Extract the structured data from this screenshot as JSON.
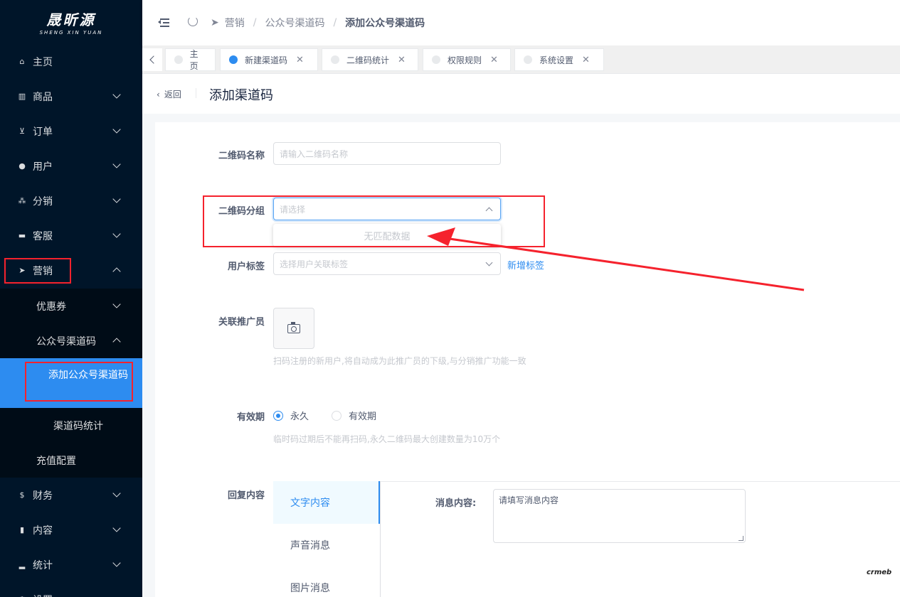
{
  "sidebar": {
    "logo_main": "晟昕源",
    "logo_sub": "SHENG XIN YUAN",
    "items": [
      {
        "label": "主页",
        "icon": "home-icon"
      },
      {
        "label": "商品",
        "icon": "shop-icon"
      },
      {
        "label": "订单",
        "icon": "cart-icon"
      },
      {
        "label": "用户",
        "icon": "user-icon"
      },
      {
        "label": "分销",
        "icon": "team-icon"
      },
      {
        "label": "客服",
        "icon": "chat-icon"
      },
      {
        "label": "营销",
        "icon": "send-icon"
      }
    ],
    "marketing_sub": {
      "coupon": "优惠券",
      "channel": "公众号渠道码",
      "add_channel": "添加公众号渠道码",
      "channel_stats": "渠道码统计",
      "recharge": "充值配置"
    },
    "bottom_items": [
      {
        "label": "财务",
        "icon": "dollar-icon"
      },
      {
        "label": "内容",
        "icon": "book-icon"
      },
      {
        "label": "统计",
        "icon": "bar-chart-icon"
      },
      {
        "label": "设置",
        "icon": "gear-icon"
      }
    ]
  },
  "header": {
    "breadcrumb": [
      "营销",
      "公众号渠道码",
      "添加公众号渠道码"
    ]
  },
  "tabs": [
    {
      "label": "主页"
    },
    {
      "label": "新建渠道码"
    },
    {
      "label": "二维码统计"
    },
    {
      "label": "权限规则"
    },
    {
      "label": "系统设置"
    }
  ],
  "page": {
    "back": "返回",
    "title": "添加渠道码"
  },
  "form": {
    "qr_name_label": "二维码名称",
    "qr_name_placeholder": "请输入二维码名称",
    "qr_group_label": "二维码分组",
    "qr_group_placeholder": "请选择",
    "qr_group_empty": "无匹配数据",
    "user_tag_label": "用户标签",
    "user_tag_placeholder": "选择用户关联标签",
    "add_tag": "新增标签",
    "promoter_label": "关联推广员",
    "promoter_tip": "扫码注册的新用户,将自动成为此推广员的下级,与分销推广功能一致",
    "validity_label": "有效期",
    "validity_options": [
      "永久",
      "有效期"
    ],
    "validity_tip": "临时码过期后不能再扫码,永久二维码最大创建数量为10万个",
    "reply_label": "回复内容",
    "reply_types": [
      "文字内容",
      "声音消息",
      "图片消息"
    ],
    "message_label": "消息内容:",
    "message_placeholder": "请填写消息内容"
  },
  "brand_mark": "crmeb",
  "colors": {
    "accent": "#2d8cf0",
    "sidebar": "#001529",
    "highlight": "#f5222d"
  }
}
